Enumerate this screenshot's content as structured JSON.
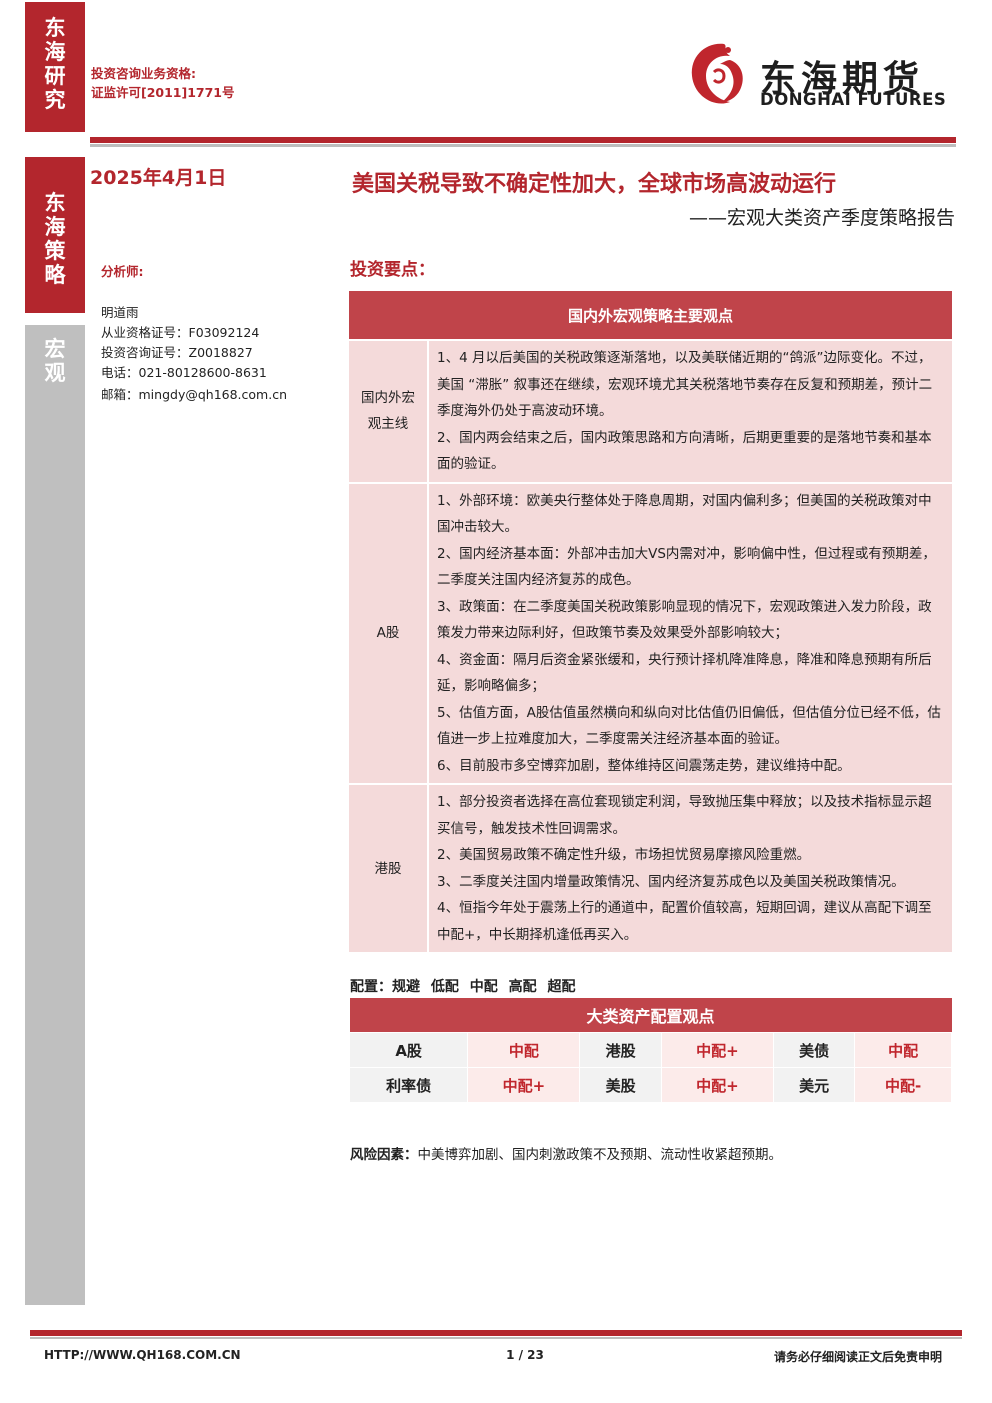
{
  "sidebar": {
    "tab1": [
      "东",
      "海",
      "研",
      "究"
    ],
    "tab2": [
      "东",
      "海",
      "策",
      "略"
    ],
    "tab3": [
      "宏",
      "观"
    ]
  },
  "header": {
    "qualification_line1": "投资咨询业务资格:",
    "qualification_line2": "证监许可[2011]1771号",
    "logo_cn": "东海期货",
    "logo_en": "DONGHAI FUTURES"
  },
  "report": {
    "date": "2025年4月1日",
    "title": "美国关税导致不确定性加大，全球市场高波动运行",
    "subtitle": "——宏观大类资产季度策略报告"
  },
  "analyst": {
    "label": "分析师:",
    "name": "明道雨",
    "license": "从业资格证号：F03092124",
    "consult": "投资咨询证号：Z0018827",
    "phone": "电话：021-80128600-8631",
    "email": "邮箱：mingdy@qh168.com.cn"
  },
  "key_points": {
    "label": "投资要点：",
    "table_title": "国内外宏观策略主要观点",
    "rows": [
      {
        "category": [
          "国内外宏",
          "观主线"
        ],
        "points": [
          "1、4 月以后美国的关税政策逐渐落地，以及美联储近期的“鸽派”边际变化。不过，美国 “滞胀” 叙事还在继续，宏观环境尤其关税落地节奏存在反复和预期差，预计二季度海外仍处于高波动环境。",
          "2、国内两会结束之后，国内政策思路和方向清晰，后期更重要的是落地节奏和基本面的验证。"
        ]
      },
      {
        "category": [
          "A股"
        ],
        "points": [
          "1、外部环境：欧美央行整体处于降息周期，对国内偏利多；但美国的关税政策对中国冲击较大。",
          "2、国内经济基本面：外部冲击加大VS内需对冲，影响偏中性，但过程或有预期差，二季度关注国内经济复苏的成色。",
          "3、政策面：在二季度美国关税政策影响显现的情况下，宏观政策进入发力阶段，政策发力带来边际利好，但政策节奏及效果受外部影响较大；",
          "4、资金面：隔月后资金紧张缓和，央行预计择机降准降息，降准和降息预期有所后延，影响略偏多；",
          "5、估值方面，A股估值虽然横向和纵向对比估值仍旧偏低，但估值分位已经不低，估值进一步上拉难度加大，二季度需关注经济基本面的验证。",
          "6、目前股市多空博弈加剧，整体维持区间震荡走势，建议维持中配。"
        ]
      },
      {
        "category": [
          "港股"
        ],
        "points": [
          "1、部分投资者选择在高位套现锁定利润，导致抛压集中释放；以及技术指标显示超买信号，触发技术性回调需求。",
          "2、美国贸易政策不确定性升级，市场担忧贸易摩擦风险重燃。",
          "3、二季度关注国内增量政策情况、国内经济复苏成色以及美国关税政策情况。",
          "4、恒指今年处于震荡上行的通道中，配置价值较高，短期回调，建议从高配下调至中配+，中长期择机逢低再买入。"
        ]
      }
    ]
  },
  "allocation": {
    "config_label": "配置：规避 低配 中配 高配 超配",
    "table_title": "大类资产配置观点",
    "rows": [
      [
        {
          "asset": "A股",
          "view": "中配"
        },
        {
          "asset": "港股",
          "view": "中配+"
        },
        {
          "asset": "美债",
          "view": "中配"
        }
      ],
      [
        {
          "asset": "利率债",
          "view": "中配+"
        },
        {
          "asset": "美股",
          "view": "中配+"
        },
        {
          "asset": "美元",
          "view": "中配-"
        }
      ]
    ]
  },
  "risk": {
    "label": "风险因素：",
    "text": "中美博弈加剧、国内刺激政策不及预期、流动性收紧超预期。"
  },
  "footer": {
    "url": "HTTP://WWW.QH168.COM.CN",
    "page": "1 / 23",
    "disclaimer": "请务必仔细阅读正文后免责申明"
  },
  "colors": {
    "brand_red": "#b3262d",
    "header_red": "#c0444a",
    "cell_pink": "#f4dada",
    "sidebar_grey": "#bfbfbf"
  }
}
